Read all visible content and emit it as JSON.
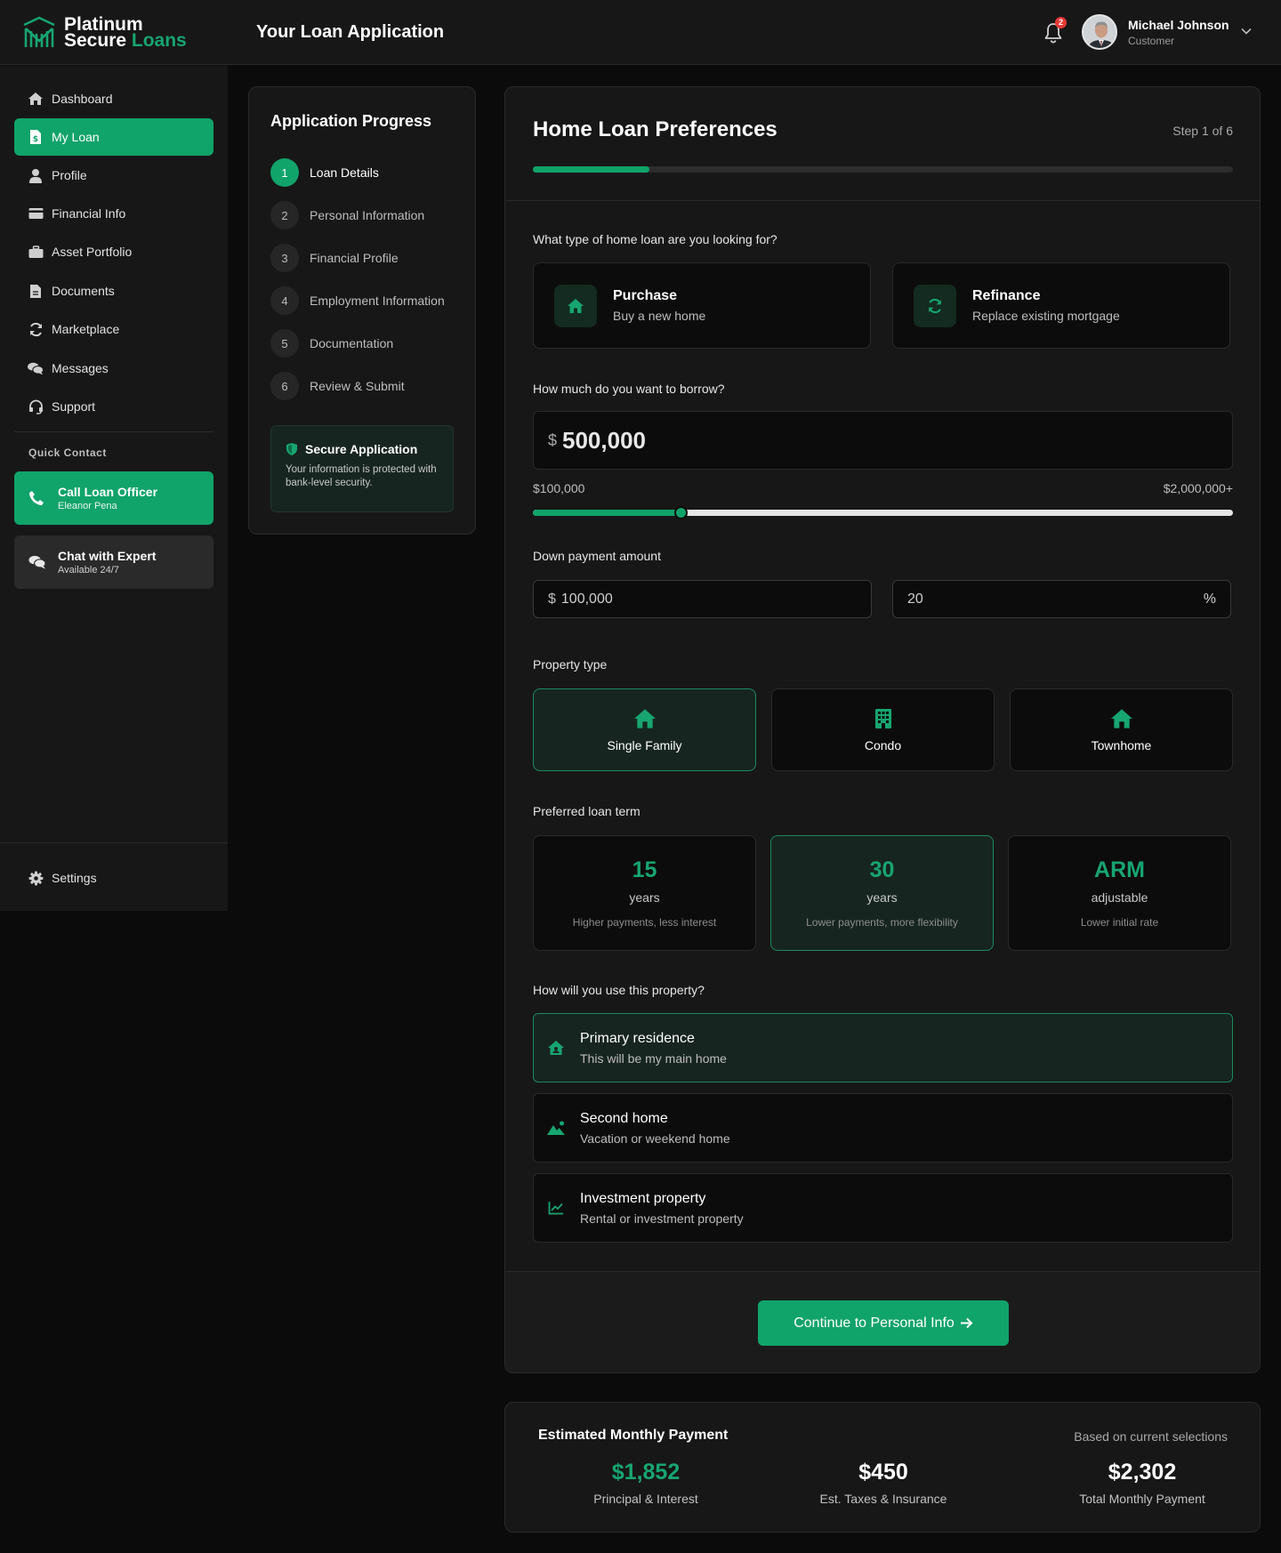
{
  "header": {
    "brand_line1": "Platinum",
    "brand_line2a": "Secure",
    "brand_line2b": "Loans",
    "page_title": "Your Loan Application",
    "notification_count": "2",
    "user_name": "Michael Johnson",
    "user_role": "Customer"
  },
  "sidebar": {
    "items": [
      {
        "label": "Dashboard",
        "icon": "home-icon"
      },
      {
        "label": "My Loan",
        "icon": "file-dollar-icon",
        "active": true
      },
      {
        "label": "Profile",
        "icon": "user-icon"
      },
      {
        "label": "Financial Info",
        "icon": "credit-card-icon"
      },
      {
        "label": "Asset Portfolio",
        "icon": "briefcase-icon"
      },
      {
        "label": "Documents",
        "icon": "document-icon"
      },
      {
        "label": "Marketplace",
        "icon": "sync-icon"
      },
      {
        "label": "Messages",
        "icon": "chat-icon"
      },
      {
        "label": "Support",
        "icon": "headset-icon"
      }
    ],
    "quick_contact_title": "Quick Contact",
    "call": {
      "title": "Call Loan Officer",
      "sub": "Eleanor Pena"
    },
    "chat": {
      "title": "Chat with Expert",
      "sub": "Available 24/7"
    },
    "settings_label": "Settings"
  },
  "progress": {
    "title": "Application Progress",
    "steps": [
      {
        "num": "1",
        "label": "Loan Details"
      },
      {
        "num": "2",
        "label": "Personal Information"
      },
      {
        "num": "3",
        "label": "Financial Profile"
      },
      {
        "num": "4",
        "label": "Employment Information"
      },
      {
        "num": "5",
        "label": "Documentation"
      },
      {
        "num": "6",
        "label": "Review & Submit"
      }
    ],
    "active_step": 1,
    "secure_title": "Secure Application",
    "secure_text": "Your information is protected with bank-level security."
  },
  "form": {
    "title": "Home Loan Preferences",
    "step_text": "Step 1 of 6",
    "progress_fraction": 0.1667,
    "loan_type_question": "What type of home loan are you looking for?",
    "loan_types": [
      {
        "title": "Purchase",
        "sub": "Buy a new home"
      },
      {
        "title": "Refinance",
        "sub": "Replace existing mortgage"
      }
    ],
    "borrow_question": "How much do you want to borrow?",
    "currency_symbol": "$",
    "borrow_amount": "500,000",
    "range_min": "$100,000",
    "range_max": "$2,000,000+",
    "slider_fraction": 0.2105,
    "down_payment_label": "Down payment amount",
    "down_payment_amount": "100,000",
    "down_payment_percent": "20",
    "percent_symbol": "%",
    "property_type_label": "Property type",
    "property_types": [
      {
        "label": "Single Family",
        "selected": true
      },
      {
        "label": "Condo"
      },
      {
        "label": "Townhome"
      }
    ],
    "term_label": "Preferred loan term",
    "terms": [
      {
        "big": "15",
        "unit": "years",
        "desc": "Higher payments, less interest"
      },
      {
        "big": "30",
        "unit": "years",
        "desc": "Lower payments, more flexibility",
        "selected": true
      },
      {
        "big": "ARM",
        "unit": "adjustable",
        "desc": "Lower initial rate"
      }
    ],
    "usage_question": "How will you use this property?",
    "usages": [
      {
        "title": "Primary residence",
        "sub": "This will be my main home",
        "selected": true
      },
      {
        "title": "Second home",
        "sub": "Vacation or weekend home"
      },
      {
        "title": "Investment property",
        "sub": "Rental or investment property"
      }
    ],
    "continue_label": "Continue to Personal Info"
  },
  "estimate": {
    "title": "Estimated Monthly Payment",
    "note": "Based on current selections",
    "items": [
      {
        "value": "$1,852",
        "label": "Principal & Interest"
      },
      {
        "value": "$450",
        "label": "Est. Taxes & Insurance"
      },
      {
        "value": "$2,302",
        "label": "Total Monthly Payment"
      }
    ]
  },
  "colors": {
    "accent": "#10a36a",
    "background": "#0b0b0b",
    "panel": "#171717",
    "badge": "#e53935"
  }
}
